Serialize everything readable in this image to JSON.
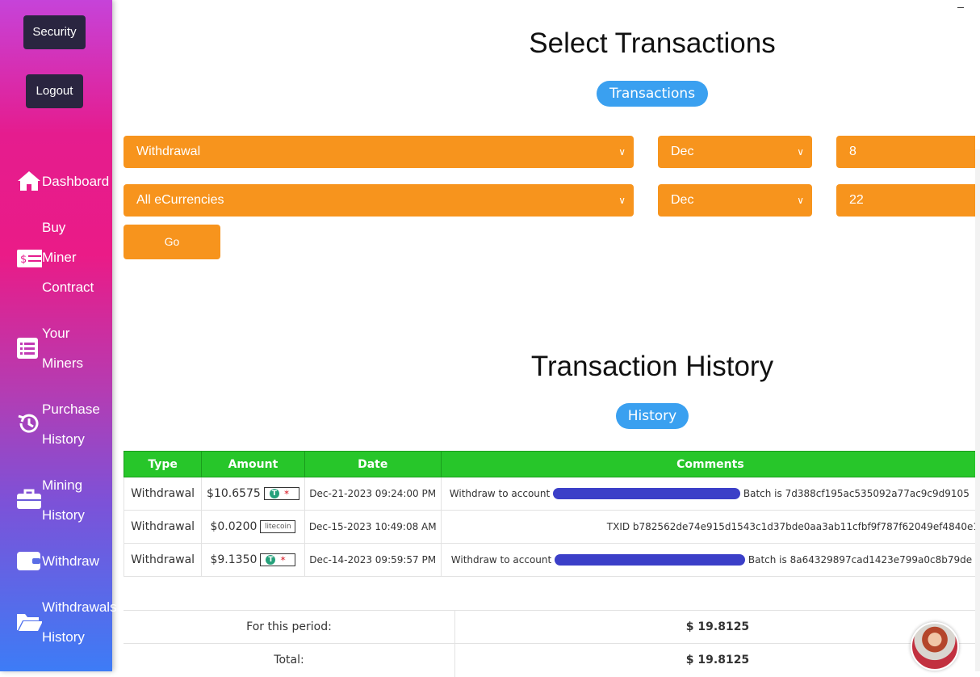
{
  "sidebar": {
    "security_label": "Security",
    "logout_label": "Logout",
    "items": [
      {
        "label_lines": [
          "Dashboard"
        ],
        "icon": "home-icon"
      },
      {
        "label_lines": [
          "Buy",
          "Miner",
          "Contract"
        ],
        "icon": "dollar-card-icon"
      },
      {
        "label_lines": [
          "Your",
          "Miners"
        ],
        "icon": "list-icon"
      },
      {
        "label_lines": [
          "Purchase",
          "History"
        ],
        "icon": "history-icon"
      },
      {
        "label_lines": [
          "Mining",
          "History"
        ],
        "icon": "briefcase-icon"
      },
      {
        "label_lines": [
          "Withdraw"
        ],
        "icon": "wallet-icon"
      },
      {
        "label_lines": [
          "Withdrawals",
          "History"
        ],
        "icon": "folder-icon"
      }
    ]
  },
  "select_section": {
    "title": "Select Transactions",
    "pill": "Transactions",
    "type_select": "Withdrawal",
    "currency_select": "All eCurrencies",
    "from_month": "Dec",
    "from_day": "8",
    "to_month": "Dec",
    "to_day": "22",
    "go_label": "Go"
  },
  "history_section": {
    "title": "Transaction History",
    "pill": "History",
    "columns": [
      "Type",
      "Amount",
      "Date",
      "Comments"
    ],
    "rows": [
      {
        "type": "Withdrawal",
        "amount": "$10.6575",
        "coin": "tether",
        "date": "Dec-21-2023 09:24:00 PM",
        "comment_prefix": "Withdraw to account",
        "comment_suffix": "Batch is 7d388cf195ac535092a77ac9c9d9105"
      },
      {
        "type": "Withdrawal",
        "amount": "$0.0200",
        "coin": "litecoin",
        "coin_label": "litecoin",
        "date": "Dec-15-2023 10:49:08 AM",
        "comment_prefix": "",
        "comment_suffix": "TXID b782562de74e915d1543c1d37bde0aa3ab11cfbf9f787f62049ef4840e1"
      },
      {
        "type": "Withdrawal",
        "amount": "$9.1350",
        "coin": "tether",
        "date": "Dec-14-2023 09:59:57 PM",
        "comment_prefix": "Withdraw to account",
        "comment_suffix": "Batch is 8a64329897cad1423e799a0c8b79de"
      }
    ],
    "period_label": "For this period:",
    "period_value": "$ 19.8125",
    "total_label": "Total:",
    "total_value": "$ 19.8125"
  }
}
